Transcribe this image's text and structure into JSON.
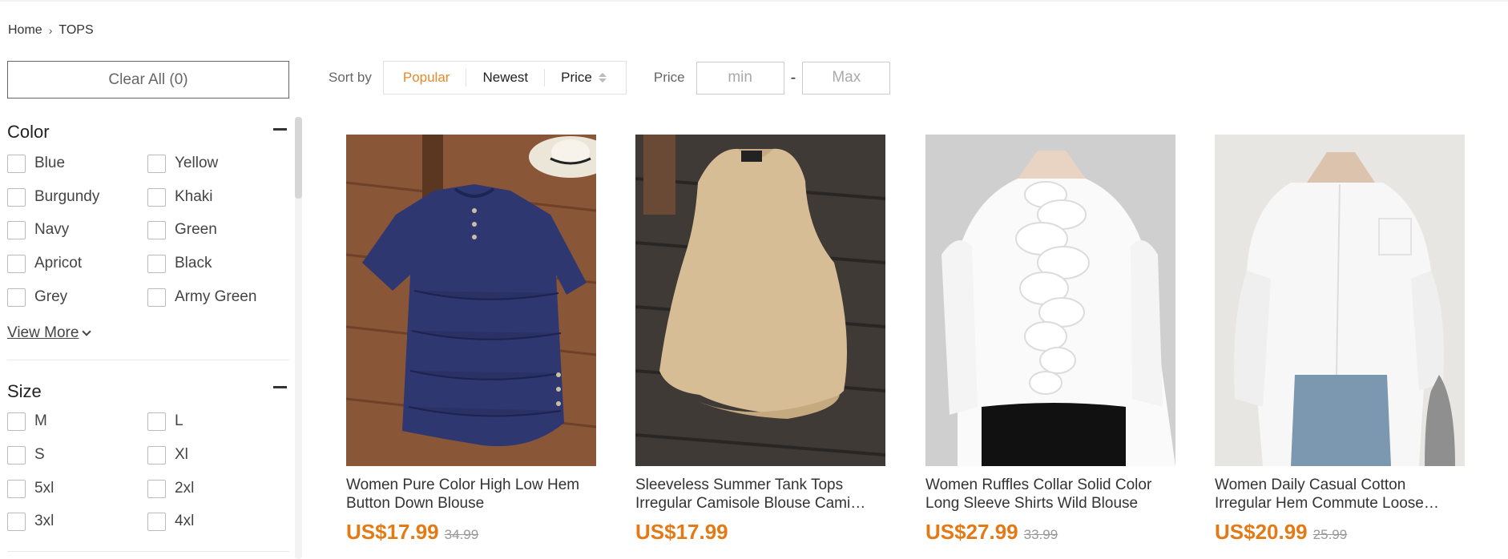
{
  "breadcrumb": {
    "home": "Home",
    "current": "TOPS"
  },
  "filters": {
    "clear_label": "Clear All (0)",
    "color": {
      "title": "Color",
      "options": [
        "Blue",
        "Yellow",
        "Burgundy",
        "Khaki",
        "Navy",
        "Green",
        "Apricot",
        "Black",
        "Grey",
        "Army Green"
      ],
      "view_more": "View More"
    },
    "size": {
      "title": "Size",
      "options": [
        "M",
        "L",
        "S",
        "Xl",
        "5xl",
        "2xl",
        "3xl",
        "4xl"
      ]
    }
  },
  "toolbar": {
    "sort_label": "Sort by",
    "sort_options": [
      "Popular",
      "Newest",
      "Price"
    ],
    "active_sort": "Popular",
    "price_label": "Price",
    "min_placeholder": "min",
    "max_placeholder": "Max",
    "dash": "-"
  },
  "products": [
    {
      "title": "Women Pure Color High Low Hem Button Down Blouse",
      "price": "US$17.99",
      "original_price": "34.99"
    },
    {
      "title": "Sleeveless Summer Tank Tops Irregular Camisole Blouse Cami For…",
      "price": "US$17.99",
      "original_price": ""
    },
    {
      "title": "Women Ruffles Collar Solid Color Long Sleeve Shirts Wild Blouse",
      "price": "US$27.99",
      "original_price": "33.99"
    },
    {
      "title": "Women Daily Casual Cotton Irregular Hem Commute Loose Shirts",
      "price": "US$20.99",
      "original_price": "25.99"
    }
  ],
  "colors": {
    "accent": "#e48a2a",
    "price": "#e47a15"
  }
}
